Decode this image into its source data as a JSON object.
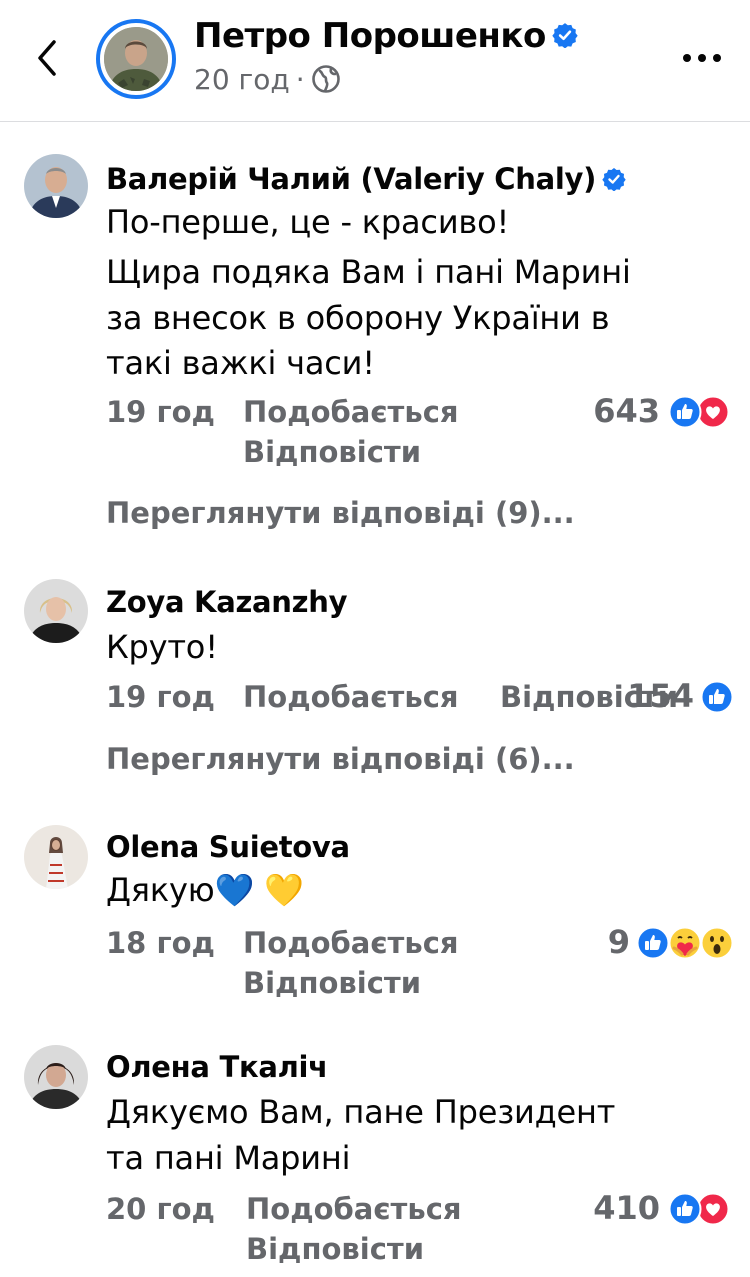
{
  "header": {
    "page_name": "Петро Порошенко",
    "time": "20 год",
    "separator": "·",
    "back_icon": "chevron-left-icon",
    "more_icon": "ellipsis-icon",
    "globe_icon": "globe-icon"
  },
  "colors": {
    "verified": "#1877f2",
    "secondary_text": "#65676b",
    "like_reaction": "#1877f2",
    "love_reaction": "#f0284a"
  },
  "comments": [
    {
      "author": "Валерій Чалий (Valeriy Chaly)",
      "verified": true,
      "lines": [
        "По-перше, це - красиво!",
        "Щира подяка Вам і пані Марині",
        "за внесок в оборону України в",
        "такі важкі часи!"
      ],
      "time": "19 год",
      "like_label": "Подобається",
      "reply_label": "Відповісти",
      "reaction_count": "643",
      "reactions": [
        "like",
        "love"
      ],
      "view_replies": "Переглянути відповіді (9)..."
    },
    {
      "author": "Zoya Kazanzhy",
      "verified": false,
      "lines": [
        "Круто!"
      ],
      "time": "19 год",
      "like_label": "Подобається",
      "reply_label": "Відповісти",
      "reaction_count": "154",
      "reactions": [
        "like"
      ],
      "view_replies": "Переглянути відповіді (6)..."
    },
    {
      "author": "Olena Suietova",
      "verified": false,
      "lines": [
        "Дякую💙 💛"
      ],
      "time": "18 год",
      "like_label": "Подобається",
      "reply_label": "Відповісти",
      "reaction_count": "9",
      "reactions": [
        "like",
        "care",
        "wow"
      ]
    },
    {
      "author": "Олена Ткаліч",
      "verified": false,
      "lines": [
        "Дякуємо Вам, пане Президент",
        "та пані Марині"
      ],
      "time": "20 год",
      "like_label": "Подобається",
      "reply_label": "Відповісти",
      "reaction_count": "410",
      "reactions": [
        "like",
        "love"
      ]
    }
  ]
}
